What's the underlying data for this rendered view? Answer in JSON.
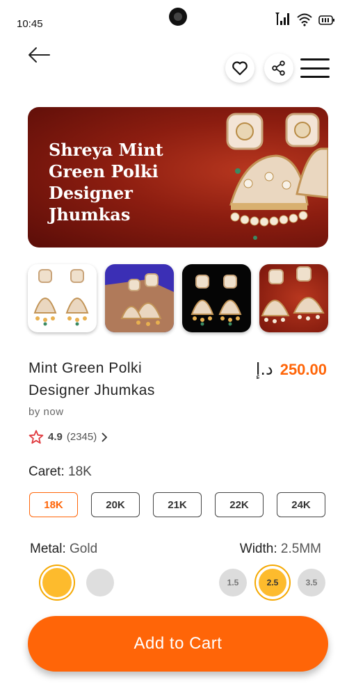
{
  "status_bar": {
    "time": "10:45"
  },
  "hero": {
    "title": "Shreya Mint Green Polki Designer Jhumkas"
  },
  "product": {
    "name": "Mint Green Polki Designer Jhumkas",
    "currency": "د.إ",
    "price": "250.00",
    "seller": "by now",
    "rating": "4.9",
    "rating_count": "(2345)"
  },
  "caret": {
    "label": "Caret:",
    "value": "18K",
    "options": [
      "18K",
      "20K",
      "21K",
      "22K",
      "24K"
    ],
    "selected": "18K"
  },
  "metal": {
    "label": "Metal:",
    "value": "Gold",
    "colors": {
      "gold": "#fdbb2d",
      "silver": "#dedede"
    }
  },
  "width": {
    "label": "Width:",
    "value": "2.5MM",
    "options": [
      "1.5",
      "2.5",
      "3.5"
    ],
    "selected": "2.5"
  },
  "cart_button": {
    "label": "Add to Cart"
  },
  "colors": {
    "accent": "#ff6508",
    "gold": "#fdbb2d",
    "hero_bg": "#8c1d10"
  },
  "icons": [
    "back-arrow-icon",
    "heart-icon",
    "share-icon",
    "hamburger-menu-icon",
    "star-icon",
    "chevron-right-icon",
    "signal-icon",
    "wifi-icon",
    "battery-icon"
  ]
}
